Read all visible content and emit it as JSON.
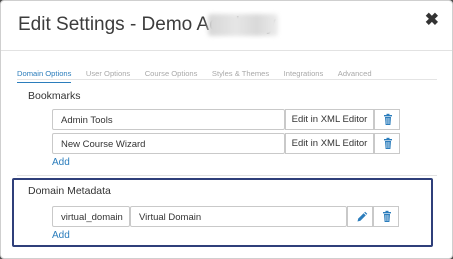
{
  "modal": {
    "title": "Edit Settings - Demo Academy",
    "close_glyph": "✖"
  },
  "tabs": [
    {
      "label": "Domain Options",
      "active": true
    },
    {
      "label": "User Options",
      "active": false
    },
    {
      "label": "Course Options",
      "active": false
    },
    {
      "label": "Styles & Themes",
      "active": false
    },
    {
      "label": "Integrations",
      "active": false
    },
    {
      "label": "Advanced",
      "active": false
    }
  ],
  "bookmarks": {
    "heading": "Bookmarks",
    "items": [
      {
        "value": "Admin Tools",
        "edit_label": "Edit in XML Editor",
        "delete_icon": "trash-icon"
      },
      {
        "value": "New Course Wizard",
        "edit_label": "Edit in XML Editor",
        "delete_icon": "trash-icon"
      }
    ],
    "add_label": "Add"
  },
  "metadata": {
    "heading": "Domain Metadata",
    "items": [
      {
        "key": "virtual_domain",
        "value": "Virtual Domain",
        "edit_icon": "pencil-icon",
        "delete_icon": "trash-icon"
      }
    ],
    "add_label": "Add"
  },
  "colors": {
    "accent": "#2b7dbc",
    "highlight_border": "#2f3f7a"
  }
}
